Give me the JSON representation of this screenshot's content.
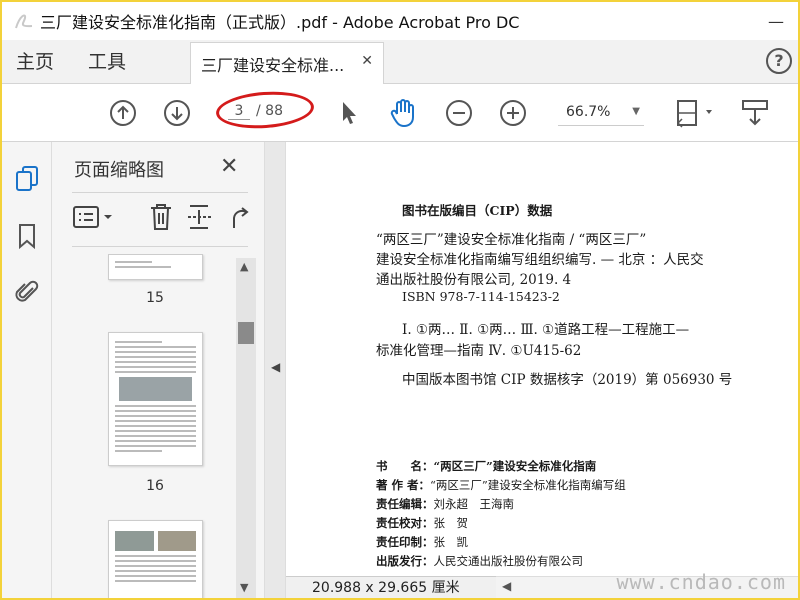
{
  "window": {
    "title": "三厂建设安全标准化指南（正式版）.pdf - Adobe Acrobat Pro DC",
    "minimize": "—",
    "close": "✕"
  },
  "tabs": {
    "home": "主页",
    "tools": "工具",
    "document_tab": "三厂建设安全标准...",
    "help": "?"
  },
  "toolbar": {
    "current_page": "3",
    "total_pages": "/ 88",
    "zoom": "66.7%"
  },
  "thumbnail_panel": {
    "title": "页面缩略图",
    "pages": [
      "15",
      "16"
    ]
  },
  "document": {
    "cip_heading": "图书在版编目（CIP）数据",
    "cip_lines": [
      "“两区三厂”建设安全标准化指南 / “两区三厂”",
      "建设安全标准化指南编写组组织编写. — 北京 ：人民交",
      "通出版社股份有限公司, 2019. 4",
      "ISBN  978-7-114-15423-2",
      "Ⅰ. ①两…   Ⅱ. ①两…   Ⅲ. ①道路工程—工程施工—",
      "标准化管理—指南   Ⅳ. ①U415-62",
      "中国版本图书馆 CIP 数据核字（2019）第 056930 号"
    ],
    "credits": [
      {
        "label": "书　　名：",
        "value": "“两区三厂”建设安全标准化指南"
      },
      {
        "label": "著 作 者：",
        "value": "“两区三厂”建设安全标准化指南编写组"
      },
      {
        "label": "责任编辑：",
        "value": "刘永超　王海南"
      },
      {
        "label": "责任校对：",
        "value": "张　贺"
      },
      {
        "label": "责任印制：",
        "value": "张　凯"
      },
      {
        "label": "出版发行：",
        "value": "人民交通出版社股份有限公司"
      }
    ]
  },
  "status": {
    "page_size": "20.988 x 29.665 厘米"
  },
  "watermark": "www.cndao.com",
  "colors": {
    "accent_blue": "#1a73c9",
    "highlight_red": "#d41b1b",
    "frame_yellow": "#f3d23a"
  }
}
